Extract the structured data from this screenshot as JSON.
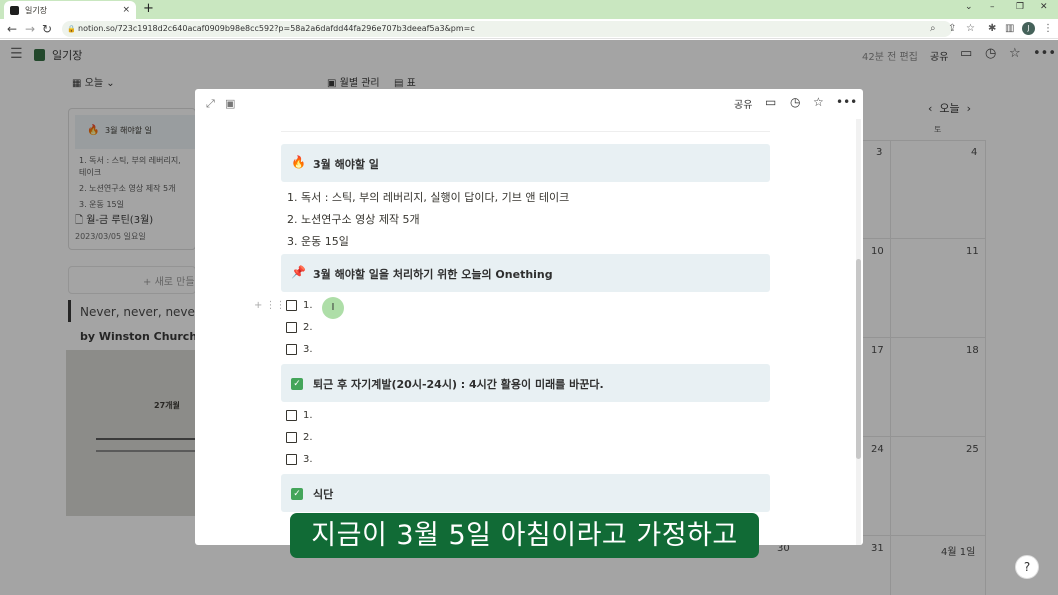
{
  "browser": {
    "tab_title": "일기장",
    "tab_close": "×",
    "new_tab": "+",
    "url": "notion.so/723c1918d2c640acaf0909b98e8cc592?p=58a2a6dafdd44fa296e707b3deeaf5a3&pm=c",
    "window_controls": [
      "⌄",
      "–",
      "❐",
      "✕"
    ],
    "profile_initial": "J"
  },
  "notion": {
    "page_name": "일기장",
    "edited": "42분 전 편집",
    "share": "공유",
    "view_today": "오늘",
    "view_monthly": "월별 관리",
    "view_table": "표",
    "card": {
      "title": "3월 해야할 일",
      "items": [
        "1.  독서 : 스틱, 부의 레버리지,",
        "     테이크",
        "2.  노션연구소 영상 제작 5개",
        "3.  운동 15일"
      ],
      "routine": "월-금 루틴(3월)",
      "date": "2023/03/05 일요일"
    },
    "new_card": "새로 만들",
    "quote": "Never, never, never",
    "byline": "by Winston Churchill",
    "graph_label": "27개월",
    "calendar": {
      "today": "오늘",
      "saturday": "토",
      "days": [
        "3",
        "4",
        "10",
        "11",
        "17",
        "18",
        "24",
        "25",
        "30",
        "31",
        "4월 1일"
      ]
    },
    "help": "?"
  },
  "modal": {
    "share": "공유",
    "callout1": "3월 해야할 일",
    "list1": [
      "1.  독서 : 스틱, 부의 레버리지, 실행이 답이다, 기브 앤 테이크",
      "2.  노션연구소 영상 제작 5개",
      "3.  운동 15일"
    ],
    "callout2": "3월 해야할 일을 처리하기 위한 오늘의 Onething",
    "todos1": [
      "1.",
      "2.",
      "3."
    ],
    "callout3": "퇴근 후 자기계발(20시-24시) : 4시간 활용이 미래를 바꾼다.",
    "todos2": [
      "1.",
      "2.",
      "3."
    ],
    "callout4": "식단",
    "cursor": "I"
  },
  "subtitle": "지금이 3월 5일 아침이라고 가정하고"
}
